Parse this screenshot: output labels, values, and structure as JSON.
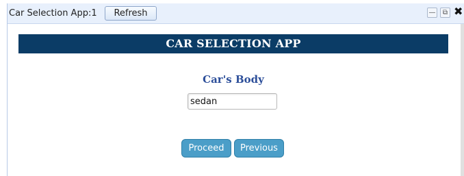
{
  "window": {
    "title": "Car Selection App:1",
    "refresh_label": "Refresh",
    "minimize_glyph": "—",
    "popout_glyph": "⧉",
    "close_glyph": "✖"
  },
  "app": {
    "header": "CAR SELECTION APP",
    "section_label": "Car's Body",
    "body_input_value": "sedan",
    "proceed_label": "Proceed",
    "previous_label": "Previous"
  },
  "colors": {
    "header_bg": "#0b3c66",
    "section_label": "#2d4f9a",
    "button_bg": "#4b9ec8",
    "titlebar_bg": "#e8f0fc"
  }
}
